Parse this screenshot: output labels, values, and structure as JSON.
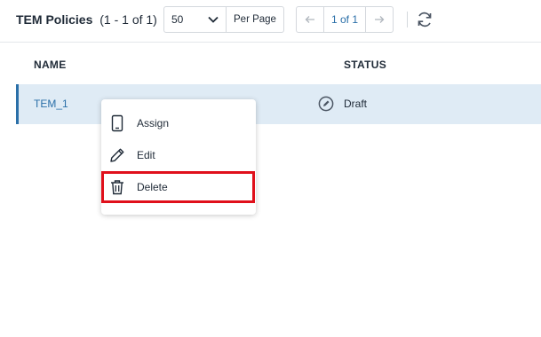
{
  "header": {
    "title": "TEM Policies",
    "count": "(1 - 1 of 1)",
    "per_page_value": "50",
    "per_page_label": "Per Page",
    "page_indicator": "1 of 1",
    "prev_icon": "arrow-left-icon",
    "next_icon": "arrow-right-icon",
    "refresh_icon": "refresh-icon"
  },
  "table": {
    "columns": [
      "NAME",
      "STATUS"
    ],
    "rows": [
      {
        "name": "TEM_1",
        "status": "Draft",
        "status_icon": "edit-circle-icon"
      }
    ]
  },
  "context_menu": {
    "items": [
      {
        "label": "Assign",
        "icon": "phone-icon"
      },
      {
        "label": "Edit",
        "icon": "pencil-icon"
      },
      {
        "label": "Delete",
        "icon": "trash-icon",
        "highlighted": true
      }
    ]
  },
  "colors": {
    "accent": "#2a6fa8",
    "selected_row_bg": "#dfebf5",
    "highlight_border": "#e0101b",
    "text": "#1f2a37",
    "border": "#d4d8dd"
  }
}
